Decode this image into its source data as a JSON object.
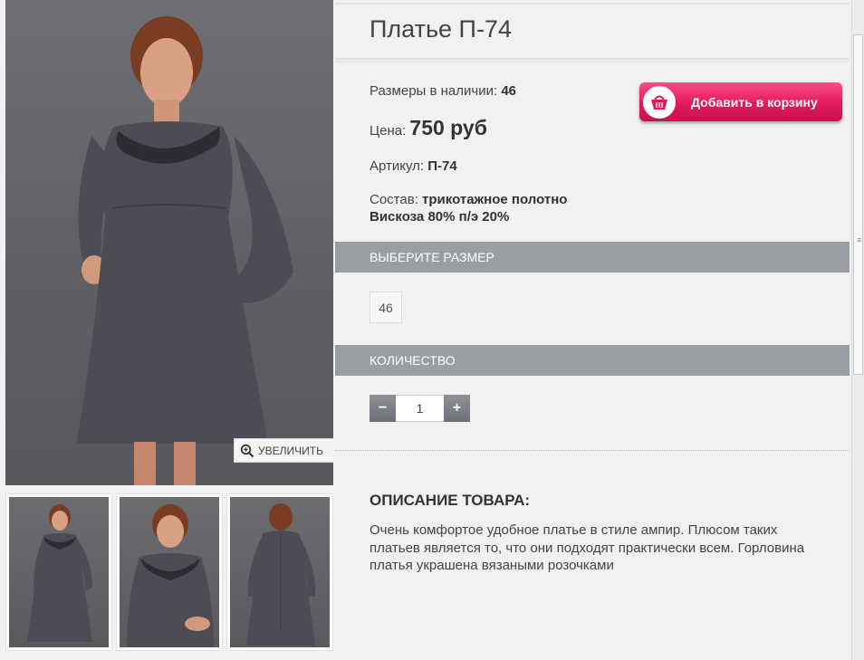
{
  "product": {
    "title": "Платье П-74",
    "sizes_label": "Размеры в наличии:",
    "sizes_value": "46",
    "price_label": "Цена:",
    "price_value": "750 руб",
    "article_label": "Артикул:",
    "article_value": "П-74",
    "composition_label": "Состав:",
    "composition_line1": "трикотажное полотно",
    "composition_line2": "Вискоза 80% п/э 20%"
  },
  "cart": {
    "label": "Добавить в корзину",
    "icon": "basket-icon"
  },
  "zoom": {
    "label": "УВЕЛИЧИТЬ",
    "icon": "magnifier-plus-icon"
  },
  "size_section": {
    "title": "ВЫБЕРИТЕ РАЗМЕР",
    "options": [
      "46"
    ]
  },
  "qty_section": {
    "title": "КОЛИЧЕСТВО",
    "minus": "−",
    "plus": "+",
    "value": "1"
  },
  "description": {
    "title": "ОПИСАНИЕ ТОВАРА:",
    "text": "Очень комфортое удобное платье в стиле ампир. Плюсом таких платьев является то, что они подходят практически всем. Горловина платья украшена вязаными розочками"
  },
  "colors": {
    "accent": "#e01a5c",
    "band": "#9a9ea3",
    "dress": "#4e4b55"
  }
}
